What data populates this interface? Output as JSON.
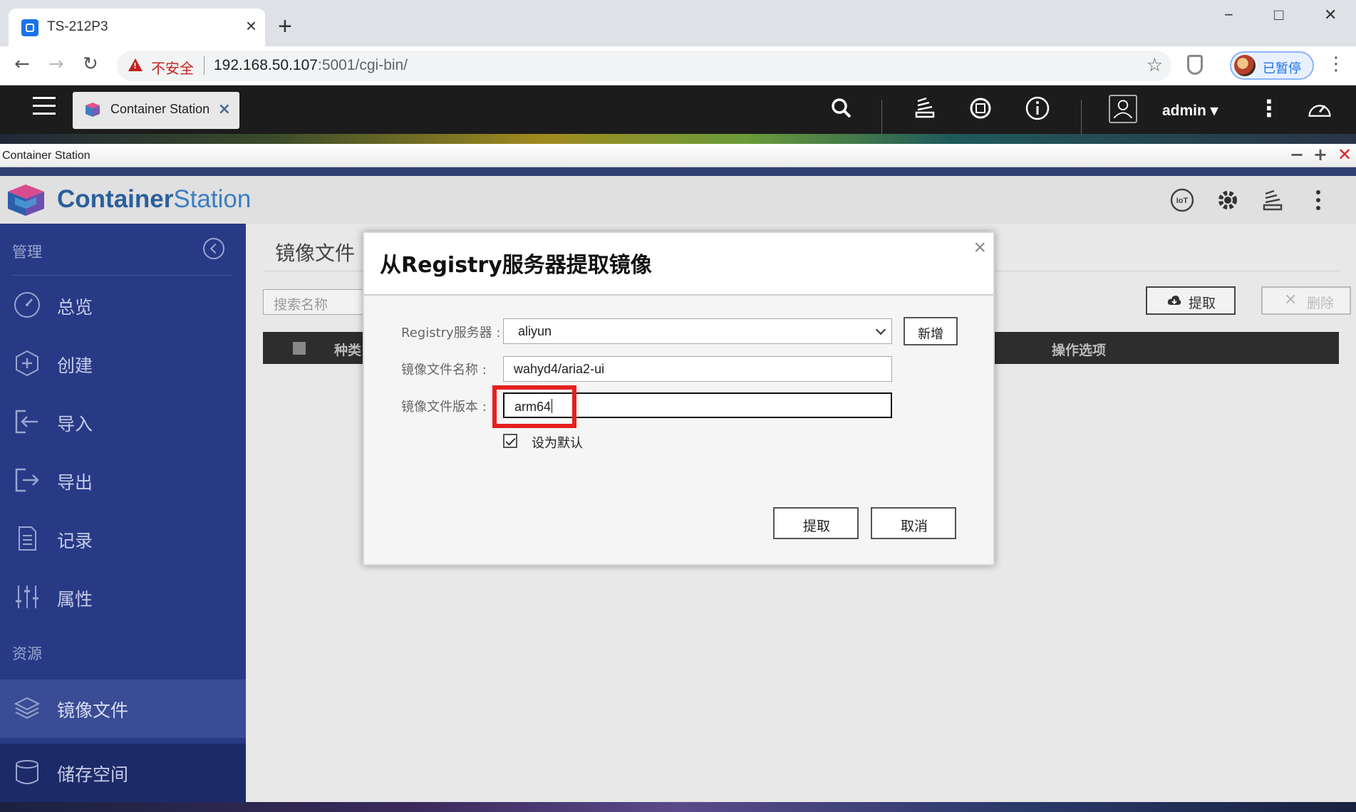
{
  "browser": {
    "tab_title": "TS-212P3",
    "tab_close": "×",
    "new_tab": "+",
    "window_controls": {
      "minimize": "−",
      "maximize": "□",
      "close": "✕"
    },
    "insecure_label": "不安全",
    "url_host": "192.168.50.107",
    "url_rest": ":5001/cgi-bin/",
    "profile_status": "已暂停",
    "menu": "⋮"
  },
  "qts": {
    "app_tab_label": "Container Station",
    "app_tab_close": "×",
    "user": "admin",
    "user_caret": "▾",
    "more": "⋮"
  },
  "app_window": {
    "title": "Container Station",
    "controls": {
      "minimize": "−",
      "maximize": "+",
      "close": "✕"
    }
  },
  "header": {
    "brand_part1": "Container",
    "brand_part2": "Station",
    "icons": [
      "iot-icon",
      "gear-icon",
      "tasks-icon",
      "more-icon"
    ]
  },
  "sidebar": {
    "section_manage": "管理",
    "section_resources": "资源",
    "items": [
      {
        "label": "总览",
        "icon": "dashboard-icon"
      },
      {
        "label": "创建",
        "icon": "create-icon"
      },
      {
        "label": "导入",
        "icon": "import-icon"
      },
      {
        "label": "导出",
        "icon": "export-icon"
      },
      {
        "label": "记录",
        "icon": "log-icon"
      },
      {
        "label": "属性",
        "icon": "properties-icon"
      }
    ],
    "resource_items": [
      {
        "label": "镜像文件",
        "icon": "layers-icon",
        "active": true
      },
      {
        "label": "储存空间",
        "icon": "storage-icon"
      }
    ]
  },
  "main": {
    "page_title": "镜像文件",
    "search_placeholder": "搜索名称",
    "pull_button": "提取",
    "delete_button": "删除",
    "columns": {
      "type": "种类",
      "actions": "操作选项"
    }
  },
  "dialog": {
    "title": "从Registry服务器提取镜像",
    "close": "×",
    "registry_label": "Registry服务器 :",
    "registry_value": "aliyun",
    "add_button": "新增",
    "image_name_label": "镜像文件名称 :",
    "image_name_value": "wahyd4/aria2-ui",
    "image_version_label": "镜像文件版本 :",
    "image_version_value": "arm64",
    "set_default_label": "设为默认",
    "set_default_checked": true,
    "ok_button": "提取",
    "cancel_button": "取消",
    "highlight_color": "#e5201f"
  }
}
